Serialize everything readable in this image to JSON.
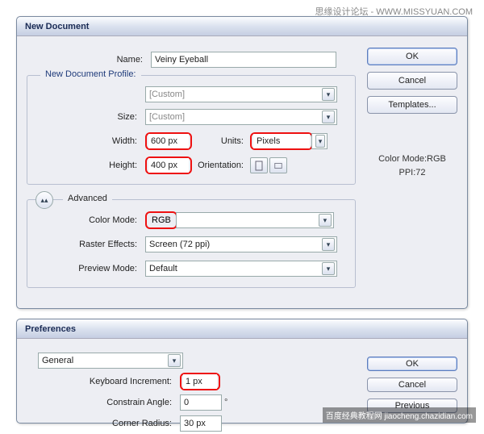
{
  "watermark_top": "思缘设计论坛 - WWW.MISSYUAN.COM",
  "watermark_bottom": "百度经典教程网  jiaocheng.chazidian.com",
  "dialog1": {
    "title": "New Document",
    "buttons": {
      "ok": "OK",
      "cancel": "Cancel",
      "templates": "Templates..."
    },
    "info_mode": "Color Mode:RGB",
    "info_ppi": "PPI:72",
    "labels": {
      "name": "Name:",
      "profile_legend": "New Document Profile:",
      "size": "Size:",
      "width": "Width:",
      "height": "Height:",
      "units": "Units:",
      "orientation": "Orientation:",
      "advanced": "Advanced",
      "colormode": "Color Mode:",
      "raster": "Raster Effects:",
      "preview": "Preview Mode:"
    },
    "values": {
      "name": "Veiny Eyeball",
      "profile": "[Custom]",
      "size": "[Custom]",
      "width": "600 px",
      "height": "400 px",
      "units": "Pixels",
      "colormode": "RGB",
      "raster": "Screen (72 ppi)",
      "preview": "Default"
    }
  },
  "dialog2": {
    "title": "Preferences",
    "section": "General",
    "buttons": {
      "ok": "OK",
      "cancel": "Cancel",
      "previous": "Previous"
    },
    "labels": {
      "kbinc": "Keyboard Increment:",
      "constrain": "Constrain Angle:",
      "corner": "Corner Radius:"
    },
    "values": {
      "kbinc": "1 px",
      "constrain": "0",
      "corner": "30 px"
    },
    "degree": "°"
  }
}
